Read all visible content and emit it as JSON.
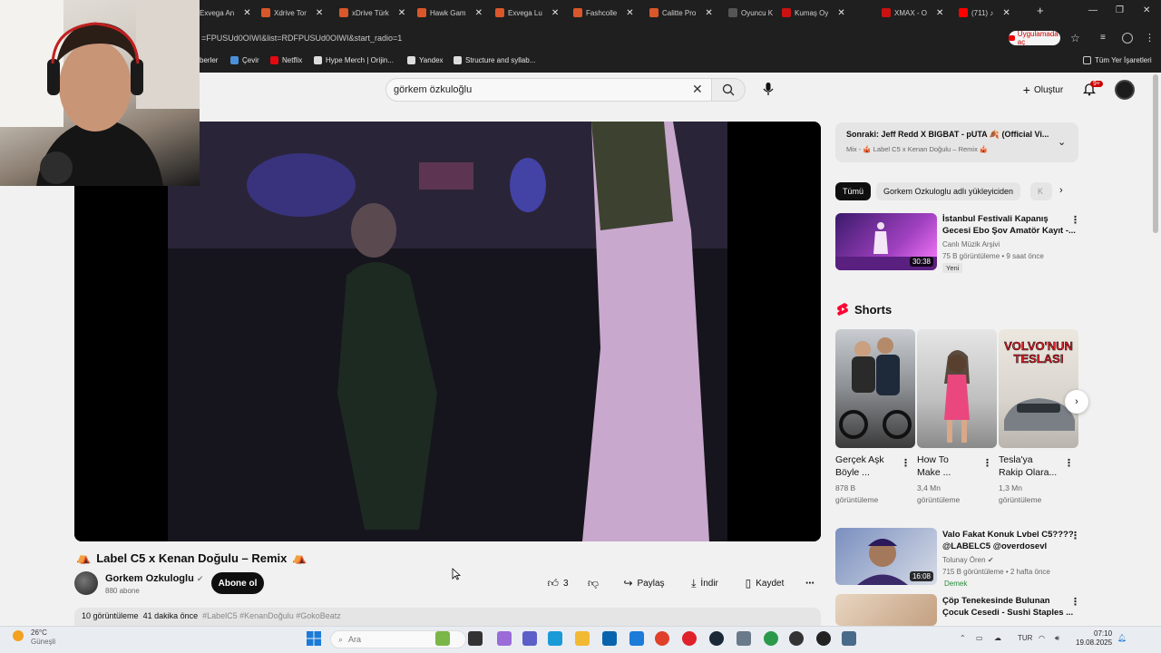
{
  "browser": {
    "tabs": [
      {
        "label": "Exvega An",
        "color": "#d9572a"
      },
      {
        "label": "Xdrive Tor",
        "color": "#d9572a"
      },
      {
        "label": "xDrive Türk",
        "color": "#d9572a"
      },
      {
        "label": "Hawk Gam",
        "color": "#d9572a"
      },
      {
        "label": "Exvega Lu",
        "color": "#d9572a"
      },
      {
        "label": "Fashcolle",
        "color": "#d9572a"
      },
      {
        "label": "Calitte Pro",
        "color": "#d9572a"
      },
      {
        "label": "Oyuncu K",
        "color": "#555555"
      },
      {
        "label": "Kumaş Oy",
        "color": "#cc1111"
      },
      {
        "label": "XMAX - O",
        "color": "#cc1111"
      },
      {
        "label": "(711) ♪",
        "color": "#ff0000"
      }
    ],
    "new_tab": "+",
    "url": "=FPUSUd0OIWI&list=RDFPUSUd0OIWI&start_radio=1",
    "open_in_app": "Uygulamada aç",
    "bookmarks": [
      {
        "label": "berler",
        "color": "#aaaaaa"
      },
      {
        "label": "Çevir",
        "color": "#4a90d9"
      },
      {
        "label": "Netflix",
        "color": "#e50914"
      },
      {
        "label": "Hype Merch | Orijin...",
        "color": "#dddddd"
      },
      {
        "label": "Yandex",
        "color": "#dddddd"
      },
      {
        "label": "Structure and syllab...",
        "color": "#dddddd"
      }
    ],
    "all_bookmarks": "Tüm Yer İşaretleri"
  },
  "youtube": {
    "search_query": "görkem özkuloğlu",
    "create_label": "Oluştur",
    "notif_count": "9+",
    "video": {
      "title": "Label C5 x Kenan Doğulu – Remix",
      "channel": "Gorkem Ozkuloglu",
      "subs": "880 abone",
      "subscribe": "Abone ol",
      "likes": "3",
      "share": "Paylaş",
      "download": "İndir",
      "save": "Kaydet",
      "views": "10 görüntüleme",
      "age": "41 dakika önce",
      "tags": "#LabelC5 #KenanDoğulu #GokoBeatz"
    },
    "playlist": {
      "next": "Sonraki: Jeff Redd X BIGBAT - pUTA 🍂 (Official Vi...",
      "mix": "Mix - 🎪 Label C5 x Kenan Doğulu – Remix 🎪"
    },
    "chips": [
      "Tümü",
      "Gorkem Ozkuloglu adlı yükleyiciden",
      "K"
    ],
    "related": [
      {
        "title1": "İstanbul Festivali Kapanış",
        "title2": "Gecesi Ebo Şov Amatör Kayıt -...",
        "channel": "Canlı Müzik Arşivi",
        "meta": "75 B görüntüleme • 9 saat önce",
        "duration": "30:38",
        "badge": "Yeni"
      },
      {
        "title1": "Valo Fakat Konuk Lvbel C5????",
        "title2": "@LABELC5 @overdosevl",
        "channel": "Tolunay Ören",
        "meta": "715 B görüntüleme • 2 hafta önce",
        "duration": "16:08",
        "badge": "Demek"
      },
      {
        "title1": "Çöp Tenekesinde Bulunan",
        "title2": "Çocuk Cesedi - Sushi Staples ...",
        "channel": "",
        "meta": "",
        "duration": "",
        "badge": ""
      }
    ],
    "shorts_header": "Shorts",
    "shorts": [
      {
        "title1": "Gerçek Aşk",
        "title2": "Böyle ...",
        "views1": "878 B",
        "views2": "görüntüleme"
      },
      {
        "title1": "How To",
        "title2": "Make ...",
        "views1": "3,4 Mn",
        "views2": "görüntüleme"
      },
      {
        "title1": "Tesla'ya",
        "title2": "Rakip Olara...",
        "views1": "1,3 Mn",
        "views2": "görüntüleme",
        "overlay": "VOLVO'NUN TESLASI"
      }
    ]
  },
  "taskbar": {
    "weather_temp": "26°C",
    "weather_desc": "Güneşli",
    "search_placeholder": "Ara",
    "lang": "TUR",
    "time": "07:10",
    "date": "19.08.2025"
  }
}
